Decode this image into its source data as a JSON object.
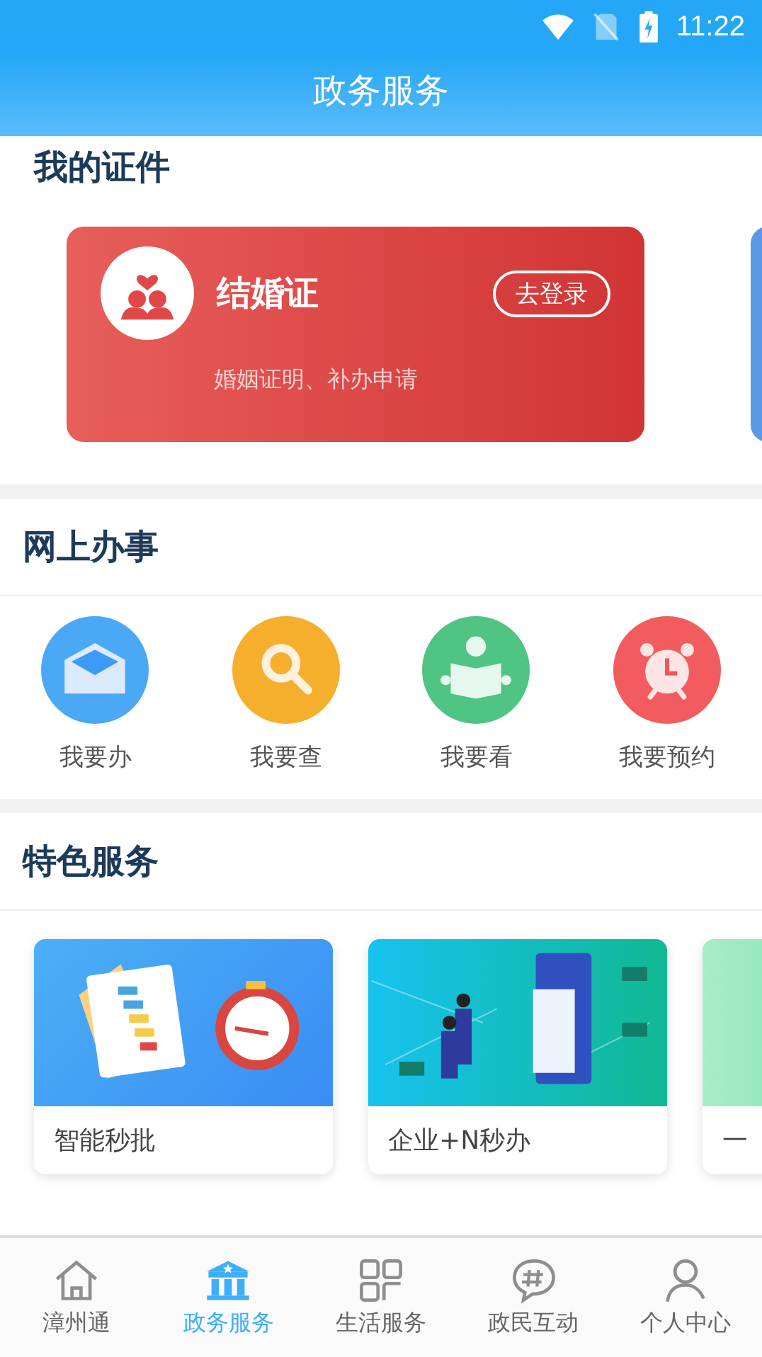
{
  "status_bar": {
    "time": "11:22"
  },
  "title": "政务服务",
  "certificates": {
    "heading": "我的证件",
    "cards": [
      {
        "kind": "marriage",
        "name": "结婚证",
        "action": "去登录",
        "subtitle": "婚姻证明、补办申请"
      },
      {
        "kind": "blank"
      }
    ]
  },
  "online": {
    "heading": "网上办事",
    "items": [
      {
        "kind": "mail",
        "label": "我要办"
      },
      {
        "kind": "search",
        "label": "我要查"
      },
      {
        "kind": "reader",
        "label": "我要看"
      },
      {
        "kind": "alarm",
        "label": "我要预约"
      }
    ]
  },
  "featured": {
    "heading": "特色服务",
    "cards": [
      {
        "kind": "approval",
        "label": "智能秒批"
      },
      {
        "kind": "business",
        "label": "企业+N秒办"
      },
      {
        "kind": "green",
        "label": "一"
      }
    ]
  },
  "nav": [
    {
      "kind": "home",
      "label": "漳州通",
      "selected": false
    },
    {
      "kind": "gov",
      "label": "政务服务",
      "selected": true
    },
    {
      "kind": "grid",
      "label": "生活服务",
      "selected": false
    },
    {
      "kind": "chat",
      "label": "政民互动",
      "selected": false
    },
    {
      "kind": "person",
      "label": "个人中心",
      "selected": false
    }
  ]
}
